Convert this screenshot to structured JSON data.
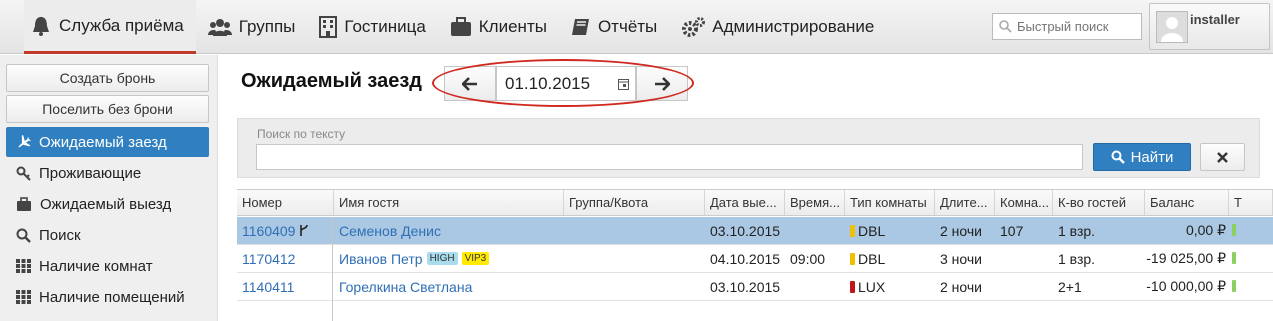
{
  "nav": {
    "items": [
      {
        "label": "Служба приёма",
        "icon": "bell-icon",
        "active": true
      },
      {
        "label": "Группы",
        "icon": "users-icon"
      },
      {
        "label": "Гостиница",
        "icon": "building-icon"
      },
      {
        "label": "Клиенты",
        "icon": "briefcase-icon"
      },
      {
        "label": "Отчёты",
        "icon": "book-icon"
      },
      {
        "label": "Администрирование",
        "icon": "gears-icon"
      }
    ],
    "quick_search_placeholder": "Быстрый поиск",
    "user_name": "installer"
  },
  "sidebar": {
    "buttons": [
      "Создать бронь",
      "Поселить без брони"
    ],
    "items": [
      {
        "label": "Ожидаемый заезд",
        "icon": "plane-icon",
        "active": true
      },
      {
        "label": "Проживающие",
        "icon": "key-icon"
      },
      {
        "label": "Ожидаемый выезд",
        "icon": "suitcase-icon"
      },
      {
        "label": "Поиск",
        "icon": "search-icon"
      },
      {
        "label": "Наличие комнат",
        "icon": "grid-icon"
      },
      {
        "label": "Наличие помещений",
        "icon": "grid-icon"
      }
    ]
  },
  "main": {
    "title": "Ожидаемый заезд",
    "date": "01.10.2015",
    "search_label": "Поиск по тексту",
    "find_label": "Найти"
  },
  "table": {
    "columns": [
      "Номер",
      "Имя гостя",
      "Группа/Квота",
      "Дата вые...",
      "Время...",
      "Тип комнаты",
      "Длите...",
      "Комна...",
      "К-во гостей",
      "Баланс",
      "Т"
    ],
    "rows": [
      {
        "number": "1160409",
        "guest": "Семенов Денис",
        "group": "",
        "date": "03.10.2015",
        "time": "",
        "room_type": "DBL",
        "room_type_color": "#f0c000",
        "duration": "2 ночи",
        "room": "107",
        "guests": "1 взр.",
        "balance": "0,00 ₽",
        "selected": true,
        "fork": true
      },
      {
        "number": "1170412",
        "guest": "Иванов Петр",
        "badges": [
          "HIGH",
          "VIP3"
        ],
        "group": "",
        "date": "04.10.2015",
        "time": "09:00",
        "room_type": "DBL",
        "room_type_color": "#f0c000",
        "duration": "3 ночи",
        "room": "",
        "guests": "1 взр.",
        "balance": "-19 025,00 ₽"
      },
      {
        "number": "1140411",
        "guest": "Горелкина Светлана",
        "group": "",
        "date": "03.10.2015",
        "time": "",
        "room_type": "LUX",
        "room_type_color": "#c0161b",
        "duration": "2 ночи",
        "room": "",
        "guests": "2+1",
        "balance": "-10 000,00 ₽"
      }
    ]
  }
}
